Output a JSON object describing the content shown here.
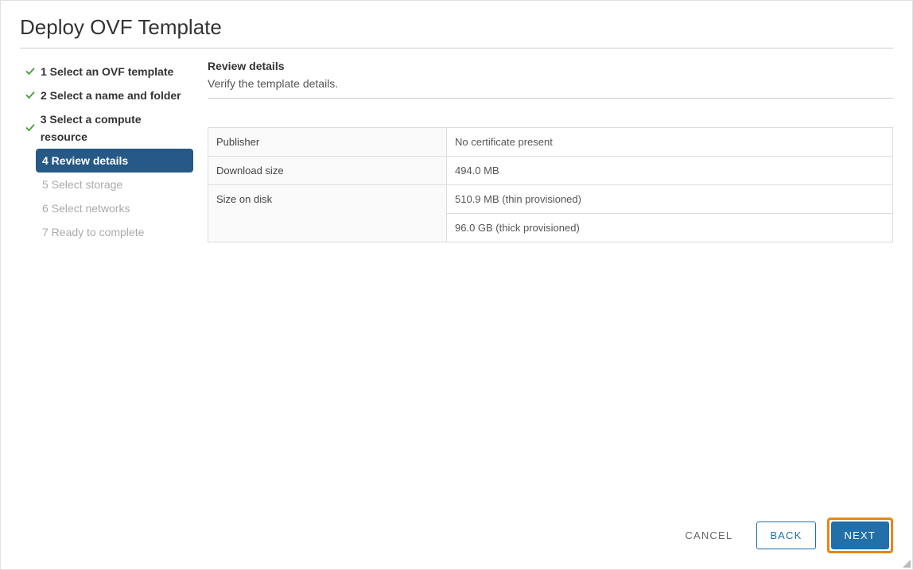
{
  "dialog": {
    "title": "Deploy OVF Template"
  },
  "steps": [
    {
      "label": "1 Select an OVF template",
      "state": "completed"
    },
    {
      "label": "2 Select a name and folder",
      "state": "completed"
    },
    {
      "label": "3 Select a compute resource",
      "state": "completed"
    },
    {
      "label": "4 Review details",
      "state": "active"
    },
    {
      "label": "5 Select storage",
      "state": "pending"
    },
    {
      "label": "6 Select networks",
      "state": "pending"
    },
    {
      "label": "7 Ready to complete",
      "state": "pending"
    }
  ],
  "content": {
    "title": "Review details",
    "subtitle": "Verify the template details."
  },
  "details": {
    "publisher_label": "Publisher",
    "publisher_value": "No certificate present",
    "download_label": "Download size",
    "download_value": "494.0 MB",
    "sizeondisk_label": "Size on disk",
    "sizeondisk_thin": "510.9 MB (thin provisioned)",
    "sizeondisk_thick": "96.0 GB (thick provisioned)"
  },
  "footer": {
    "cancel": "CANCEL",
    "back": "BACK",
    "next": "NEXT"
  }
}
